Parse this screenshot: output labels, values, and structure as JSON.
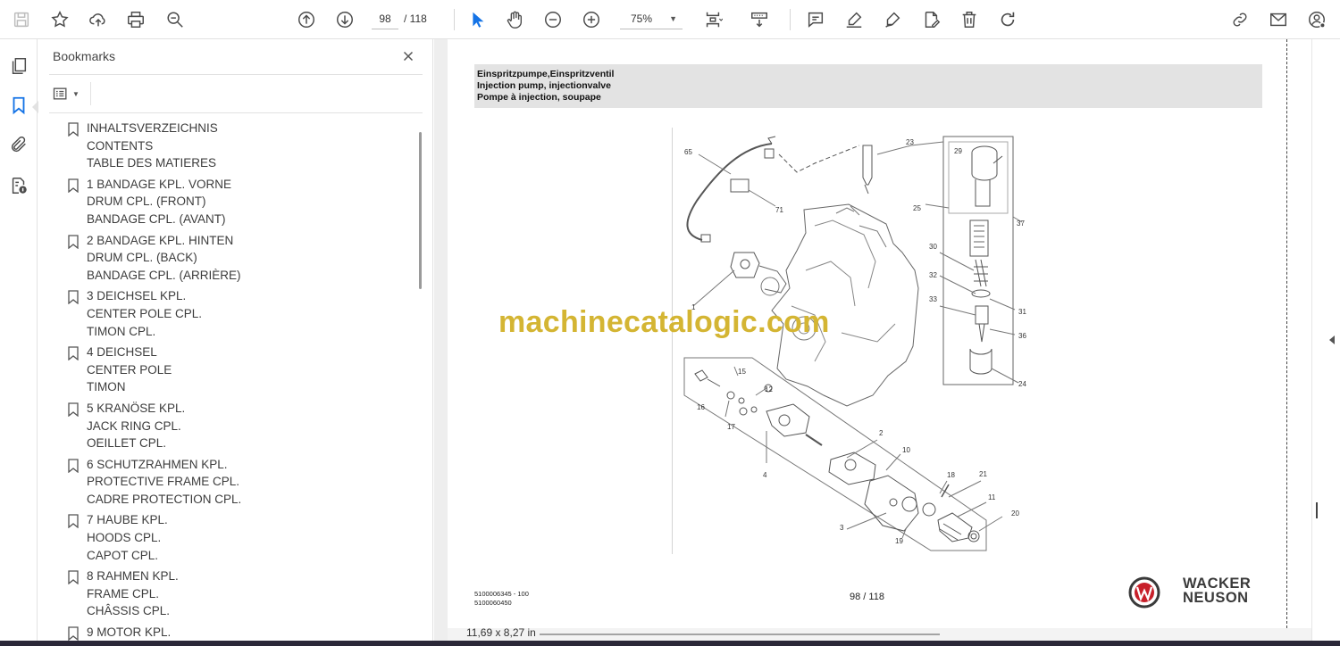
{
  "toolbar": {
    "page_current": "98",
    "page_total": "/ 118",
    "zoom": "75%",
    "icons": [
      "save-icon",
      "star-icon",
      "upload-icon",
      "print-icon",
      "zoom-search-icon",
      "page-up-icon",
      "page-down-icon",
      "cursor-icon",
      "hand-icon",
      "zoom-out-icon",
      "zoom-in-icon",
      "fit-page-icon",
      "scroll-mode-icon",
      "comment-icon",
      "highlight-icon",
      "draw-icon",
      "fill-sign-icon",
      "delete-icon",
      "rotate-icon",
      "share-link-icon",
      "email-icon",
      "account-icon"
    ]
  },
  "bookmarks": {
    "title": "Bookmarks",
    "items": [
      {
        "lines": [
          "INHALTSVERZEICHNIS",
          "CONTENTS",
          "TABLE DES MATIERES"
        ]
      },
      {
        "lines": [
          "1 BANDAGE KPL. VORNE",
          "DRUM CPL. (FRONT)",
          "BANDAGE CPL. (AVANT)"
        ]
      },
      {
        "lines": [
          "2 BANDAGE KPL. HINTEN",
          "DRUM CPL. (BACK)",
          "BANDAGE CPL. (ARRIÈRE)"
        ]
      },
      {
        "lines": [
          "3 DEICHSEL KPL.",
          "CENTER POLE CPL.",
          "TIMON CPL."
        ]
      },
      {
        "lines": [
          "4 DEICHSEL",
          "CENTER POLE",
          "TIMON"
        ]
      },
      {
        "lines": [
          "5 KRANÖSE KPL.",
          "JACK RING CPL.",
          "OEILLET CPL."
        ]
      },
      {
        "lines": [
          "6 SCHUTZRAHMEN KPL.",
          "PROTECTIVE FRAME CPL.",
          "CADRE PROTECTION CPL."
        ]
      },
      {
        "lines": [
          "7 HAUBE KPL.",
          "HOODS CPL.",
          "CAPOT CPL."
        ]
      },
      {
        "lines": [
          "8 RAHMEN KPL.",
          "FRAME CPL.",
          "CHÂSSIS CPL."
        ]
      },
      {
        "lines": [
          "9 MOTOR KPL."
        ]
      }
    ]
  },
  "document": {
    "header_de": "Einspritzpumpe,Einspritzventil",
    "header_en": "Injection pump, injectionvalve",
    "header_fr": "Pompe à injection, soupape",
    "watermark": "machinecatalogic.com",
    "doc_number_1": "5100006345 - 100",
    "doc_number_2": "5100060450",
    "page_indicator": "98 / 118",
    "brand_line1": "WACKER",
    "brand_line2": "NEUSON",
    "part_labels": [
      "65",
      "23",
      "29",
      "71",
      "25",
      "37",
      "30",
      "32",
      "31",
      "33",
      "36",
      "1",
      "24",
      "15",
      "12",
      "16",
      "17",
      "2",
      "10",
      "4",
      "18",
      "21",
      "11",
      "20",
      "3",
      "19"
    ]
  },
  "status": {
    "page_size": "11,69 x 8,27 in"
  }
}
